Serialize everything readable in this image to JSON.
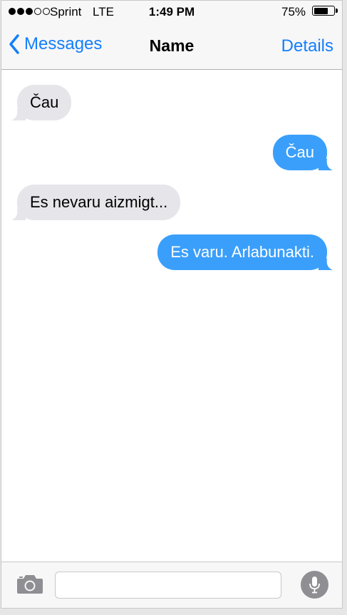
{
  "status_bar": {
    "carrier": "Sprint",
    "network": "LTE",
    "time": "1:49 PM",
    "battery_percent_text": "75%",
    "battery_level": 0.75,
    "signal_bars_filled": 3,
    "signal_bars_total": 5
  },
  "nav": {
    "back_label": "Messages",
    "title": "Name",
    "details_label": "Details"
  },
  "messages": [
    {
      "direction": "incoming",
      "text": "Čau"
    },
    {
      "direction": "outgoing",
      "text": "Čau"
    },
    {
      "direction": "incoming",
      "text": "Es nevaru aizmigt..."
    },
    {
      "direction": "outgoing",
      "text": "Es varu. Arlabunakti."
    }
  ],
  "input": {
    "value": "",
    "placeholder": ""
  },
  "colors": {
    "accent": "#147efb",
    "outgoing_bubble": "#3a9ffb",
    "incoming_bubble": "#e5e5ea",
    "bar_background": "#f7f7f7"
  },
  "icons": {
    "back": "chevron-left-icon",
    "camera": "camera-icon",
    "microphone": "microphone-icon",
    "battery": "battery-icon",
    "signal": "signal-dots-icon"
  }
}
